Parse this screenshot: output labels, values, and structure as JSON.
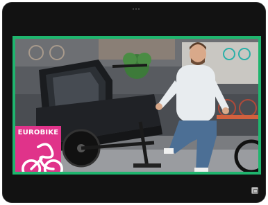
{
  "video": {
    "brand_badge": {
      "text": "EUROBIKE",
      "logo": "bicycle-logo"
    }
  },
  "colors": {
    "frame_border": "#1fb56e",
    "badge": "#e0338a",
    "device": "#121212"
  },
  "icons": {
    "corner_button": "window-icon"
  }
}
